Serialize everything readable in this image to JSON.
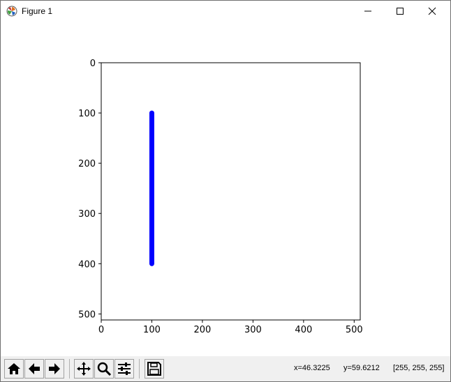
{
  "window": {
    "title": "Figure 1",
    "icon": "matplotlib-icon",
    "controls": [
      "minimize-icon",
      "maximize-icon",
      "close-icon"
    ]
  },
  "chart_data": {
    "type": "line",
    "series": [
      {
        "x": [
          100,
          100
        ],
        "y": [
          100,
          400
        ],
        "color": "#0000ff"
      }
    ],
    "xlim": [
      0,
      512
    ],
    "ylim": [
      512,
      0
    ],
    "y_inverted": true,
    "xticks": [
      0,
      100,
      200,
      300,
      400,
      500
    ],
    "yticks": [
      0,
      100,
      200,
      300,
      400,
      500
    ],
    "title": "",
    "xlabel": "",
    "ylabel": "",
    "grid": false
  },
  "toolbar": {
    "buttons": [
      "home-icon",
      "back-icon",
      "forward-icon",
      "pan-icon",
      "zoom-icon",
      "configure-subplots-icon",
      "save-icon"
    ]
  },
  "status": {
    "x": "x=46.3225",
    "y": "y=59.6212",
    "pixel": "[255, 255, 255]"
  }
}
